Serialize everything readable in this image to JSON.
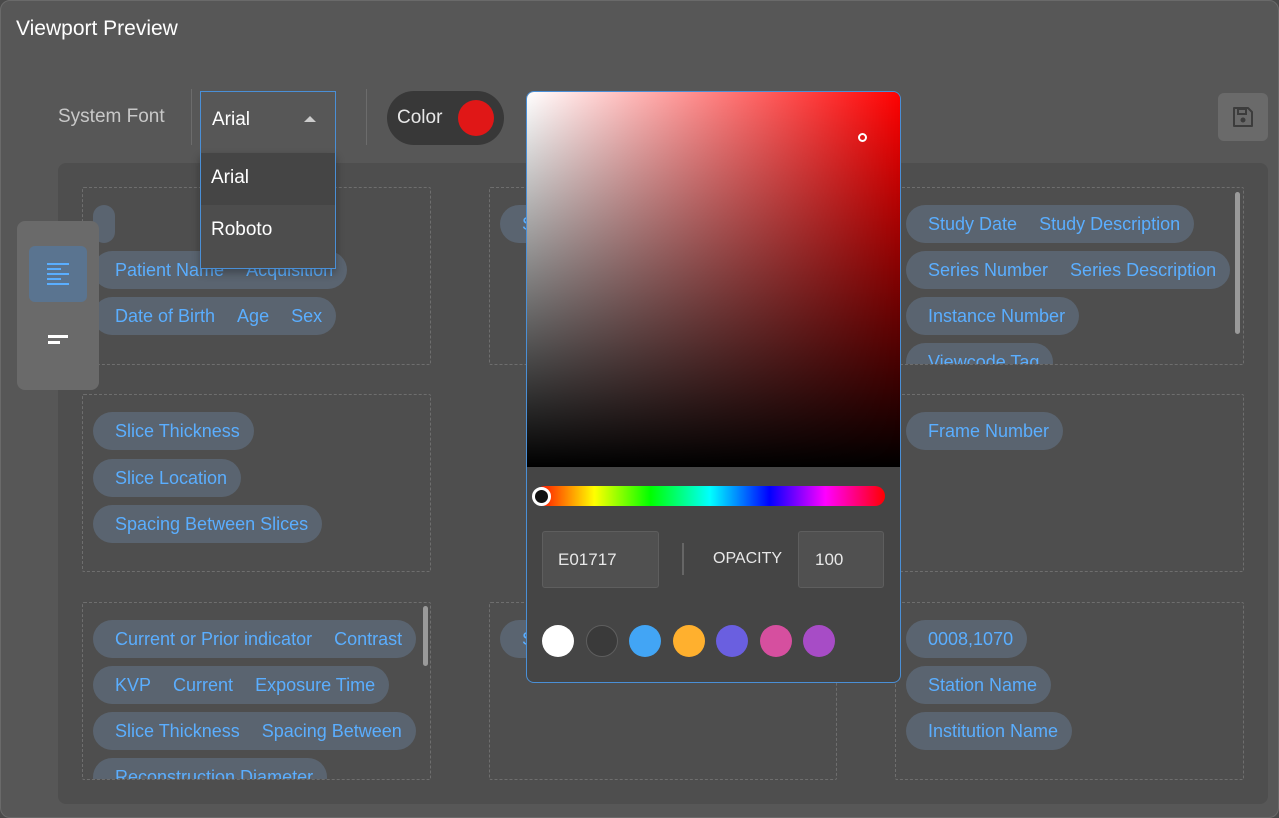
{
  "dialog": {
    "title": "Viewport Preview"
  },
  "font": {
    "label": "System Font",
    "selected": "Arial",
    "options": [
      "Arial",
      "Roboto"
    ]
  },
  "color": {
    "label": "Color",
    "value": "#E01717"
  },
  "align": {
    "options": [
      {
        "icon": "align-left-icon",
        "active": true
      },
      {
        "icon": "align-bottom-icon",
        "active": false
      }
    ]
  },
  "picker": {
    "hex": "E01717",
    "opacity_label": "OPACITY",
    "opacity": "100",
    "presets": [
      "#ffffff",
      "#3a3a3a",
      "#42a5f5",
      "#ffb02e",
      "#6a5fe0",
      "#d64f9f",
      "#a74cc6"
    ]
  },
  "cells": {
    "top_left": {
      "rows": [
        [
          ""
        ],
        [
          "Patient Name",
          "Acquisition"
        ],
        [
          "Date of Birth",
          "Age",
          "Sex"
        ]
      ]
    },
    "top_middle": {
      "rows": [
        [
          "S"
        ]
      ]
    },
    "top_right": {
      "rows": [
        [
          "Study Date",
          "Study Description"
        ],
        [
          "Series Number",
          "Series Description"
        ],
        [
          "Instance Number"
        ],
        [
          "Viewcode Tag"
        ]
      ]
    },
    "mid_left": {
      "rows": [
        [
          "Slice Thickness"
        ],
        [
          "Slice Location"
        ],
        [
          "Spacing Between Slices"
        ]
      ]
    },
    "mid_right": {
      "rows": [
        [
          "Frame Number"
        ]
      ]
    },
    "bottom_left": {
      "rows": [
        [
          "Current or Prior indicator",
          "Contrast"
        ],
        [
          "KVP",
          "Current",
          "Exposure Time"
        ],
        [
          "Slice Thickness",
          "Spacing Between"
        ],
        [
          "Reconstruction Diameter"
        ]
      ]
    },
    "bottom_middle": {
      "rows": [
        [
          "S"
        ]
      ]
    },
    "bottom_right": {
      "rows": [
        [
          "0008,1070"
        ],
        [
          "Station Name"
        ],
        [
          "Institution Name"
        ]
      ]
    }
  }
}
